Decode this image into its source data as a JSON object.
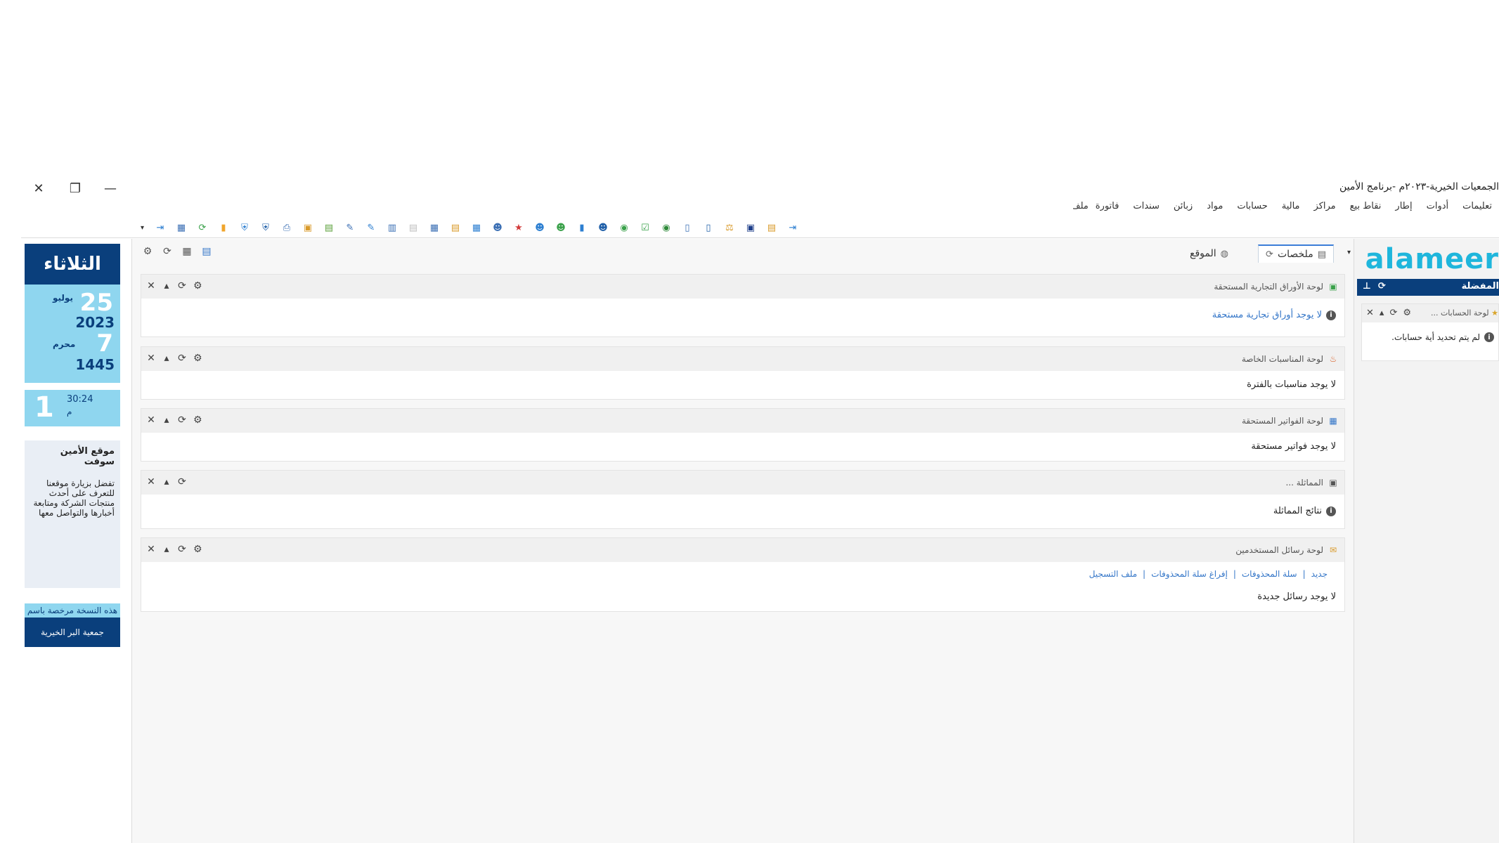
{
  "window": {
    "title": "الجمعيات الخيرية-٢٠٢٣م -برنامج الأمين",
    "close_glyph": "✕",
    "restore_glyph": "❐",
    "minimize_glyph": "—"
  },
  "menu": [
    "ملف",
    "فاتورة",
    "سندات",
    "زبائن",
    "مواد",
    "حسابات",
    "مالية",
    "مراكز",
    "نقاط بيع",
    "إطار",
    "أدوات",
    "تعليمات"
  ],
  "toolbar_icons": [
    {
      "name": "exit-icon",
      "glyph": "⇥",
      "color": "#2d7fd1"
    },
    {
      "name": "calculator-icon",
      "glyph": "▦",
      "color": "#3b6fb4"
    },
    {
      "name": "refresh-icon",
      "glyph": "⟳",
      "color": "#3aa14a"
    },
    {
      "name": "folder-icon",
      "glyph": "▮",
      "color": "#f0a52c"
    },
    {
      "name": "shield-icon",
      "glyph": "⛨",
      "color": "#2d7fd1"
    },
    {
      "name": "shield-alt-icon",
      "glyph": "⛨",
      "color": "#1f5fa8"
    },
    {
      "name": "print-icon",
      "glyph": "⎙",
      "color": "#3b6fb4"
    },
    {
      "name": "lock-icon",
      "glyph": "▣",
      "color": "#d99a2b"
    },
    {
      "name": "bottle-icon",
      "glyph": "▤",
      "color": "#5ea23e"
    },
    {
      "name": "tools-icon",
      "glyph": "✎",
      "color": "#3b6fb4"
    },
    {
      "name": "edit-icon",
      "glyph": "✎",
      "color": "#2d7fd1"
    },
    {
      "name": "barcode-icon",
      "glyph": "▥",
      "color": "#3b6fb4"
    },
    {
      "name": "invoice-icon",
      "glyph": "▤",
      "color": "#c0c0c0"
    },
    {
      "name": "report-icon",
      "glyph": "▦",
      "color": "#3b6fb4"
    },
    {
      "name": "document-icon",
      "glyph": "▤",
      "color": "#d99a2b"
    },
    {
      "name": "calendar-icon",
      "glyph": "▦",
      "color": "#2d7fd1"
    },
    {
      "name": "users-icon",
      "glyph": "☻",
      "color": "#3b6fb4"
    },
    {
      "name": "star-icon",
      "glyph": "★",
      "color": "#d23a3a"
    },
    {
      "name": "user-add-icon",
      "glyph": "☻",
      "color": "#2d7fd1"
    },
    {
      "name": "user-group-icon",
      "glyph": "☻",
      "color": "#3aa14a"
    },
    {
      "name": "folder-open-icon",
      "glyph": "▮",
      "color": "#2d7fd1"
    },
    {
      "name": "user-search-icon",
      "glyph": "☻",
      "color": "#1f5fa8"
    },
    {
      "name": "database-icon",
      "glyph": "◉",
      "color": "#3aa14a"
    },
    {
      "name": "checklist-icon",
      "glyph": "☑",
      "color": "#3aa14a"
    },
    {
      "name": "database-alt-icon",
      "glyph": "◉",
      "color": "#2f8a3a"
    },
    {
      "name": "book-icon",
      "glyph": "▯",
      "color": "#3b6fb4"
    },
    {
      "name": "book-alt-icon",
      "glyph": "▯",
      "color": "#1f5fa8"
    },
    {
      "name": "balance-icon",
      "glyph": "⚖",
      "color": "#d99a2b"
    },
    {
      "name": "files-icon",
      "glyph": "▣",
      "color": "#1f3f8a"
    },
    {
      "name": "notes-icon",
      "glyph": "▤",
      "color": "#d99a2b"
    },
    {
      "name": "export-icon",
      "glyph": "⇥",
      "color": "#2d7fd1"
    }
  ],
  "calendar": {
    "day_name": "الثلاثاء",
    "greg_day": "25",
    "greg_month": "يوليو",
    "greg_year": "2023",
    "hijri_day": "7",
    "hijri_month": "محرم",
    "hijri_year": "1445",
    "time_digit": "1",
    "time": "30:24",
    "ampm": "م"
  },
  "site": {
    "title": "موقع الأمين سوفت",
    "text": "تفضل بزيارة موقعنا للتعرف على أحدث منتجات الشركة ومتابعة أخبارها والتواصل معها"
  },
  "license": {
    "line1": "هذه النسخة مرخصة باسم",
    "line2": "جمعية البر الخيرية"
  },
  "tabs": {
    "active": "ملخصات",
    "other": "الموقع"
  },
  "widgets": [
    {
      "title": "لوحة الأوراق التجارية المستحقة",
      "message": "لا يوجد أوراق تجارية مستحقة"
    },
    {
      "title": "لوحة المناسبات الخاصة",
      "message": "لا يوجد مناسبات بالفترة"
    },
    {
      "title": "لوحة الفواتير المستحقة",
      "message": "لا يوجد فواتير مستحقة"
    },
    {
      "title": "المماثلة ...",
      "message": "نتائج المماثلة"
    },
    {
      "title": "لوحة رسائل المستخدمين",
      "message": "لا يوجد رسائل جديدة",
      "links": [
        "جديد",
        "سلة المحذوفات",
        "إفراغ سلة المحذوفات",
        "ملف التسجيل"
      ]
    }
  ],
  "right": {
    "logo": "alameer",
    "favorites": "المفضلة",
    "acct_title": "لوحة الحسابات ...",
    "acct_msg": "لم يتم تحديد أية حسابات."
  },
  "colors": {
    "brand_dark": "#0a3f7c",
    "brand_light": "#8fd6ef",
    "logo": "#1fb6dc",
    "link": "#3476c8"
  }
}
